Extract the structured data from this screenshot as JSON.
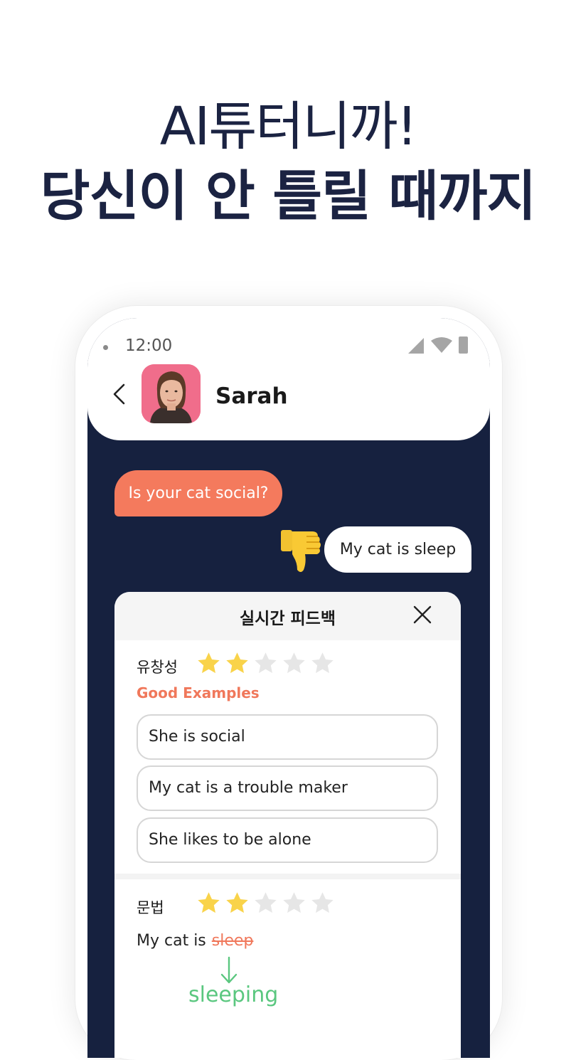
{
  "headline": {
    "line1": "AI튜터니까!",
    "line2": "당신이 안 틀릴 때까지"
  },
  "status_bar": {
    "time": "12:00"
  },
  "chat_header": {
    "contact_name": "Sarah"
  },
  "messages": {
    "incoming": "Is your cat social?",
    "outgoing": "My cat  is sleep",
    "outgoing_reaction_icon": "thumbs-down-icon"
  },
  "feedback": {
    "title": "실시간 피드백",
    "fluency": {
      "label": "유창성",
      "rating": 2,
      "max": 5,
      "good_examples_label": "Good Examples",
      "examples": [
        "She is social",
        "My cat is a trouble maker",
        "She likes to be alone"
      ]
    },
    "grammar": {
      "label": "문법",
      "rating": 2,
      "max": 5,
      "sentence_prefix": "My cat  is",
      "wrong_word": "sleep",
      "correction": "sleeping"
    }
  },
  "colors": {
    "navy": "#16213f",
    "accent_orange": "#f47a5d",
    "star_filled": "#f9d34a",
    "star_empty": "#e6e6e6",
    "correction_green": "#5ac77f"
  }
}
